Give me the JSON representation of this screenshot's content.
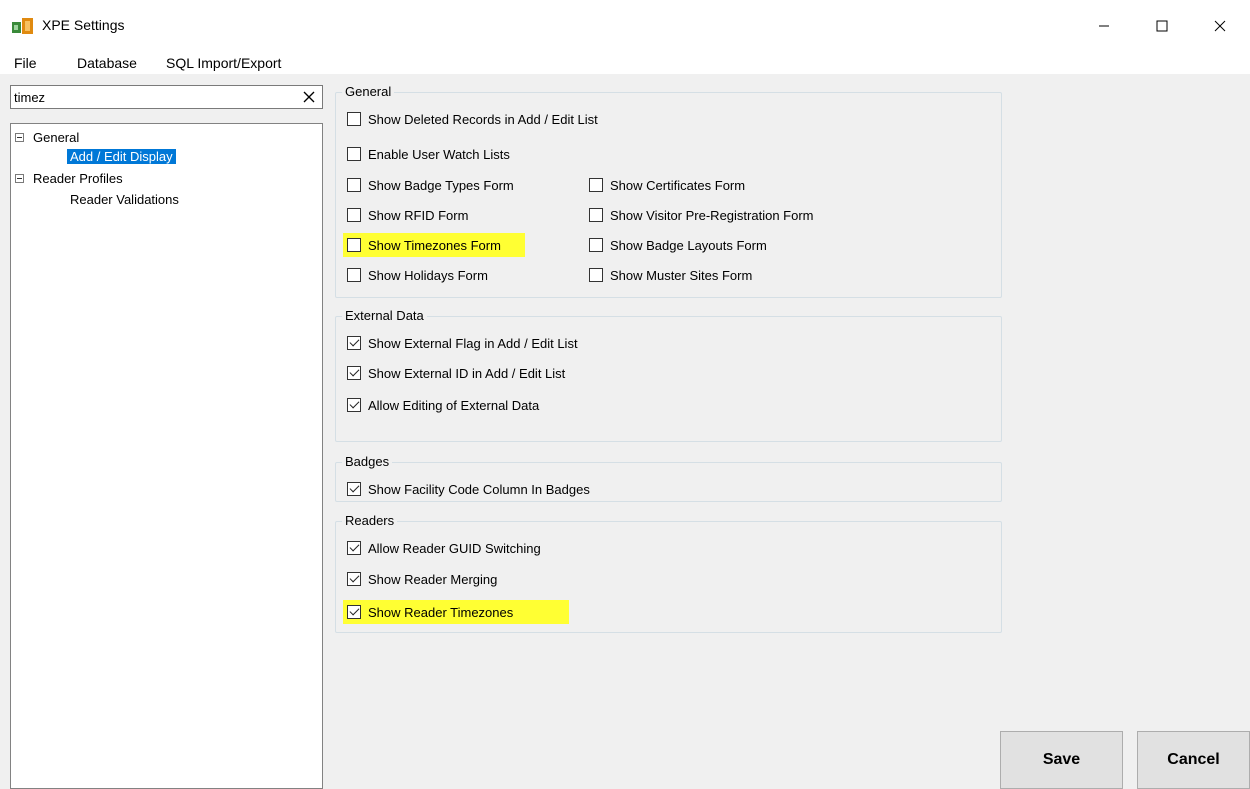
{
  "window": {
    "title": "XPE Settings",
    "icon": "app-icon",
    "controls": [
      "minimize-icon",
      "maximize-icon",
      "close-icon"
    ]
  },
  "menu": [
    "File",
    "Database",
    "SQL Import/Export"
  ],
  "search": {
    "value": "timez",
    "clear_icon": "close-icon"
  },
  "tree": {
    "nodes": [
      {
        "label": "General",
        "expander": "minus-icon",
        "level": 0
      },
      {
        "label": "Add / Edit Display",
        "level": 1,
        "selected": true
      },
      {
        "label": "Reader Profiles",
        "expander": "minus-icon",
        "level": 0
      },
      {
        "label": "Reader Validations",
        "level": 1
      }
    ]
  },
  "groups": {
    "general": {
      "title": "General",
      "items": [
        {
          "label": "Show Deleted Records in Add / Edit List",
          "checked": false
        },
        {
          "label": "Enable User Watch Lists",
          "checked": false
        },
        {
          "label": "Show Badge Types Form",
          "checked": false
        },
        {
          "label": "Show Certificates Form",
          "checked": false
        },
        {
          "label": "Show RFID Form",
          "checked": false
        },
        {
          "label": "Show Visitor Pre-Registration Form",
          "checked": false
        },
        {
          "label": "Show Timezones Form",
          "checked": false,
          "highlighted": true
        },
        {
          "label": "Show Badge Layouts Form",
          "checked": false
        },
        {
          "label": "Show Holidays Form",
          "checked": false
        },
        {
          "label": "Show Muster Sites Form",
          "checked": false
        }
      ]
    },
    "external": {
      "title": "External Data",
      "items": [
        {
          "label": "Show External Flag in Add / Edit List",
          "checked": true
        },
        {
          "label": "Show External ID in Add / Edit List",
          "checked": true
        },
        {
          "label": "Allow Editing of External Data",
          "checked": true
        }
      ]
    },
    "badges": {
      "title": "Badges",
      "items": [
        {
          "label": "Show Facility Code Column In Badges",
          "checked": true
        }
      ]
    },
    "readers": {
      "title": "Readers",
      "items": [
        {
          "label": "Allow Reader GUID Switching",
          "checked": true
        },
        {
          "label": "Show Reader Merging",
          "checked": true
        },
        {
          "label": "Show Reader Timezones",
          "checked": true,
          "highlighted": true
        }
      ]
    }
  },
  "buttons": {
    "save": "Save",
    "cancel": "Cancel"
  },
  "colors": {
    "highlight": "#ffff33",
    "selection": "#0078d7"
  }
}
